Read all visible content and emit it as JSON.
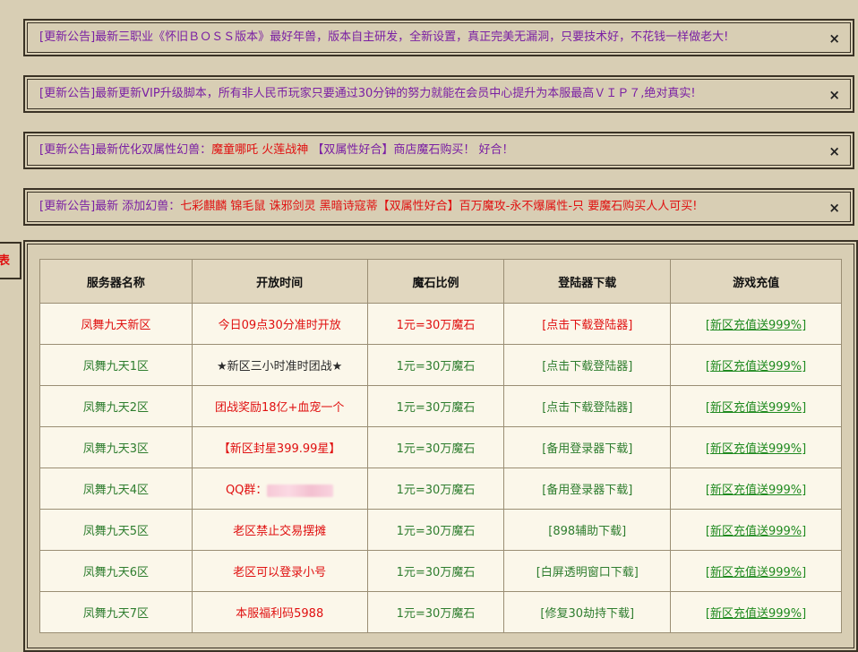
{
  "notices": [
    {
      "prefix": "[更新公告]最新三职业《怀旧ＢＯＳＳ版本》最好年兽，版本自主研发，全新设置，真正完美无漏洞，只要技术好，不花钱一样做老大!",
      "highlight": "",
      "suffix": ""
    },
    {
      "prefix": "[更新公告]最新更新VIP升级脚本，所有非人民币玩家只要通过30分钟的努力就能在会员中心提升为本服最高ＶＩＰ７,绝对真实!",
      "highlight": "",
      "suffix": ""
    },
    {
      "prefix": "[更新公告]最新优化双属性幻兽：",
      "highlight": "魔童哪吒 火莲战神",
      "suffix": " 【双属性好合】商店魔石购买！ 好合！"
    },
    {
      "prefix": "[更新公告]最新 添加幻兽：",
      "highlight": "七彩麒麟 锦毛鼠 诛邪剑灵 黑暗诗寇蒂【双属性好合】百万魔攻-永不爆属性-只 要魔石购买人人可买!",
      "suffix": ""
    }
  ],
  "close_symbol": "×",
  "side_tab_label": "表",
  "table": {
    "headers": [
      "服务器名称",
      "开放时间",
      "魔石比例",
      "登陆器下载",
      "游戏充值"
    ],
    "rows": [
      {
        "name": "凤舞九天新区",
        "time": "今日09点30分准时开放",
        "ratio": "1元=30万魔石",
        "download": "[点击下载登陆器]",
        "recharge": "[新区充值送999%]"
      },
      {
        "name": "凤舞九天1区",
        "time": "★新区三小时准时团战★",
        "ratio": "1元=30万魔石",
        "download": "[点击下载登陆器]",
        "recharge": "[新区充值送999%]"
      },
      {
        "name": "凤舞九天2区",
        "time": "团战奖励18亿+血宠一个",
        "ratio": "1元=30万魔石",
        "download": "[点击下载登陆器]",
        "recharge": "[新区充值送999%]"
      },
      {
        "name": "凤舞九天3区",
        "time": "【新区封星399.99星】",
        "ratio": "1元=30万魔石",
        "download": "[备用登录器下载]",
        "recharge": "[新区充值送999%]"
      },
      {
        "name": "凤舞九天4区",
        "time": "QQ群：",
        "ratio": "1元=30万魔石",
        "download": "[备用登录器下载]",
        "recharge": "[新区充值送999%]"
      },
      {
        "name": "凤舞九天5区",
        "time": "老区禁止交易摆摊",
        "ratio": "1元=30万魔石",
        "download": "[898辅助下载]",
        "recharge": "[新区充值送999%]"
      },
      {
        "name": "凤舞九天6区",
        "time": "老区可以登录小号",
        "ratio": "1元=30万魔石",
        "download": "[白屏透明窗口下载]",
        "recharge": "[新区充值送999%]"
      },
      {
        "name": "凤舞九天7区",
        "time": "本服福利码5988",
        "ratio": "1元=30万魔石",
        "download": "[修复30劫持下载]",
        "recharge": "[新区充值送999%]"
      }
    ]
  }
}
